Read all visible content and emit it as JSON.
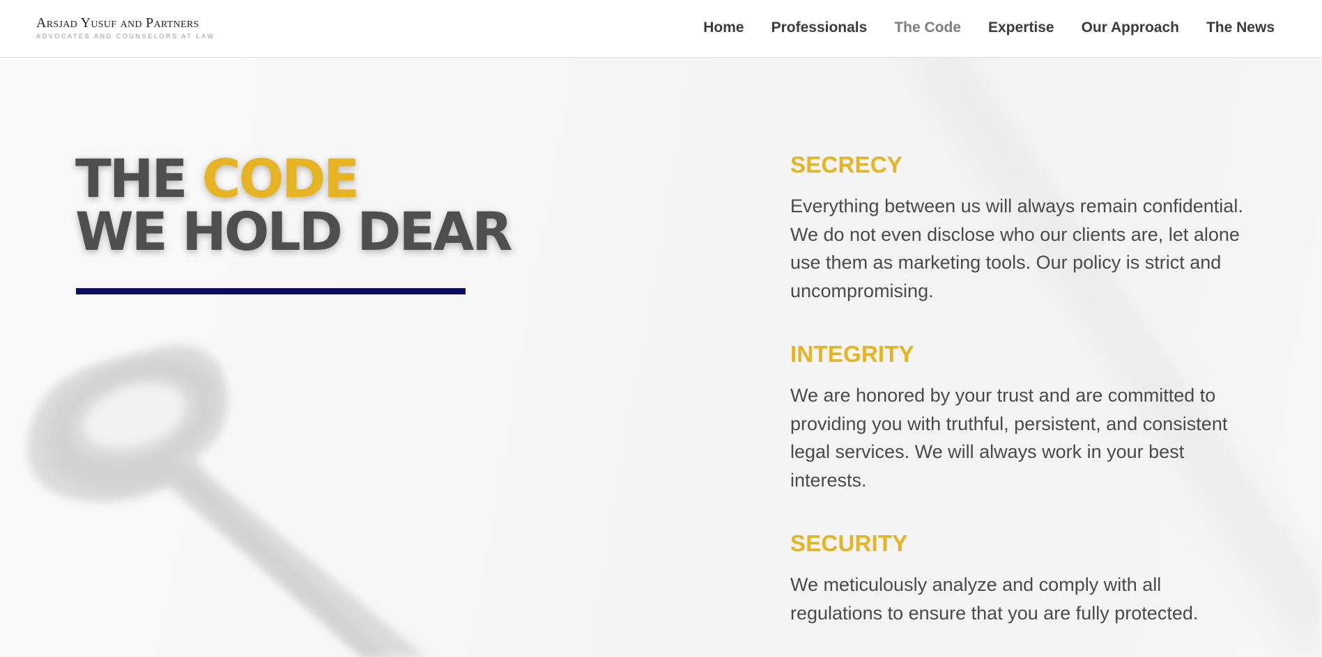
{
  "header": {
    "logo_name": "Arsjad Yusuf and Partners",
    "logo_tagline": "ADVOCATES AND COUNSELORS AT LAW",
    "nav": [
      {
        "label": "Home",
        "active": false
      },
      {
        "label": "Professionals",
        "active": false
      },
      {
        "label": "The Code",
        "active": true
      },
      {
        "label": "Expertise",
        "active": false
      },
      {
        "label": "Our Approach",
        "active": false
      },
      {
        "label": "The News",
        "active": false
      }
    ]
  },
  "hero": {
    "headline_line1_prefix": "THE ",
    "headline_line1_accent": "CODE",
    "headline_line2": "WE HOLD DEAR"
  },
  "values": [
    {
      "title": "SECRECY",
      "text": "Everything between us will always remain confidential. We do not even disclose who our clients are, let alone use them as marketing tools. Our policy is strict and uncompromising."
    },
    {
      "title": "INTEGRITY",
      "text": "We are honored by your trust and are committed to providing you with truthful, persistent, and consistent legal services. We will always work in your best interests."
    },
    {
      "title": "SECURITY",
      "text": "We meticulously analyze and comply with all regulations to ensure that you are fully protected."
    }
  ],
  "colors": {
    "accent": "#e6b422",
    "rule": "#0a0d5a",
    "text": "#4a4a4a",
    "headline": "#4f4f4f"
  },
  "icons": {
    "background_image": "vintage-key-image"
  }
}
